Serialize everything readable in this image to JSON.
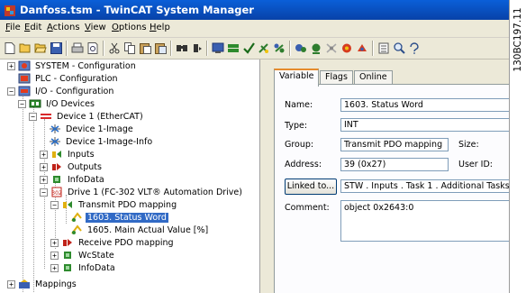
{
  "window": {
    "title": "Danfoss.tsm - TwinCAT System Manager"
  },
  "figure_id": "130BC197.11",
  "menu": [
    {
      "label": "File",
      "u": "F",
      "rest": "ile"
    },
    {
      "label": "Edit",
      "u": "E",
      "rest": "dit"
    },
    {
      "label": "Actions",
      "u": "A",
      "rest": "ctions"
    },
    {
      "label": "View",
      "u": "V",
      "rest": "iew"
    },
    {
      "label": "Options",
      "u": "O",
      "rest": "ptions"
    },
    {
      "label": "Help",
      "u": "H",
      "rest": "elp"
    }
  ],
  "toolbar_icons": [
    "new-icon",
    "open-icon",
    "open-folder-icon",
    "save-icon",
    "print-icon",
    "print-preview-icon",
    "cut-icon",
    "copy-icon",
    "paste-icon",
    "paste-special-icon",
    "find-icon",
    "find-next-icon",
    "activate-config-icon",
    "generate-mappings-icon",
    "check-config-icon",
    "activate-icon",
    "restart-icon",
    "login-icon",
    "free-run-icon",
    "scan-icon",
    "reload-icon",
    "toggle-icon",
    "show-online-icon",
    "zoom-icon",
    "help-icon"
  ],
  "tree": {
    "items": [
      {
        "label": "SYSTEM - Configuration",
        "icon": "system-config-icon"
      },
      {
        "label": "PLC - Configuration",
        "icon": "plc-config-icon"
      },
      {
        "label": "I/O - Configuration",
        "icon": "io-config-icon"
      },
      {
        "label": "I/O Devices",
        "icon": "io-devices-icon"
      },
      {
        "label": "Device 1 (EtherCAT)",
        "icon": "ethercat-device-icon"
      },
      {
        "label": "Device 1-Image",
        "icon": "image-icon"
      },
      {
        "label": "Device 1-Image-Info",
        "icon": "image-info-icon"
      },
      {
        "label": "Inputs",
        "icon": "inputs-icon"
      },
      {
        "label": "Outputs",
        "icon": "outputs-icon"
      },
      {
        "label": "InfoData",
        "icon": "infodata-icon"
      },
      {
        "label": "Drive 1 (FC-302 VLT® Automation Drive)",
        "icon": "drive-icon"
      },
      {
        "label": "Transmit PDO mapping",
        "icon": "transmit-pdo-icon"
      },
      {
        "label": "1603. Status Word",
        "icon": "variable-icon"
      },
      {
        "label": "1605. Main Actual Value [%]",
        "icon": "variable-icon"
      },
      {
        "label": "Receive PDO mapping",
        "icon": "receive-pdo-icon"
      },
      {
        "label": "WcState",
        "icon": "wcstate-icon"
      },
      {
        "label": "InfoData",
        "icon": "infodata-icon"
      },
      {
        "label": "Mappings",
        "icon": "mappings-icon"
      }
    ]
  },
  "tabs": [
    "Variable",
    "Flags",
    "Online"
  ],
  "active_tab": "Variable",
  "form": {
    "name_label": "Name:",
    "name_value": "1603. Status Word",
    "type_label": "Type:",
    "type_value": "INT",
    "group_label": "Group:",
    "group_value": "Transmit PDO mapping",
    "size_label": "Size:",
    "address_label": "Address:",
    "address_value": "39 (0x27)",
    "userid_label": "User ID:",
    "linked_button": "Linked to...",
    "linked_value": "STW . Inputs . Task 1 . Additional Tasks",
    "comment_label": "Comment:",
    "comment_value": "object 0x2643:0"
  },
  "colors": {
    "titlebar": "#0a5fd8",
    "selection": "#316ac5",
    "tab_highlight": "#e68b2c"
  }
}
